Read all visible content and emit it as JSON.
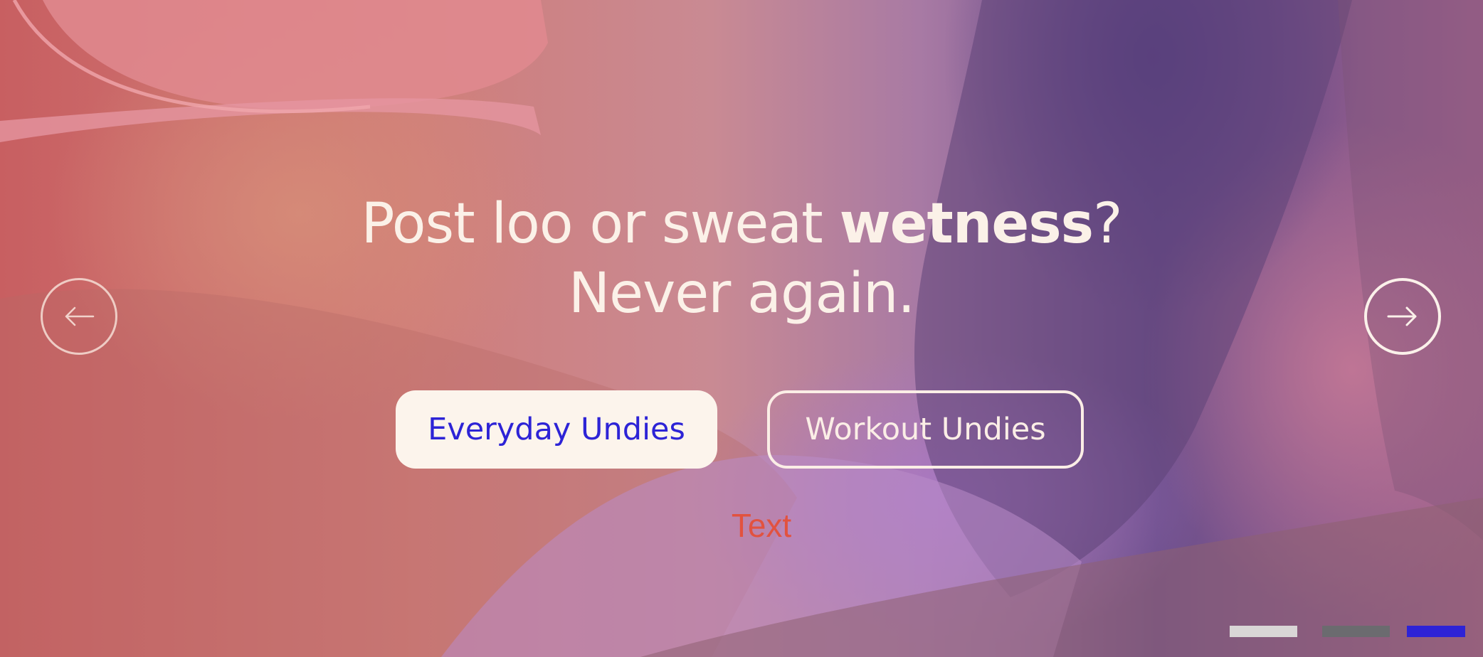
{
  "hero": {
    "headline_prefix": "Post loo or sweat ",
    "headline_bold": "wetness",
    "headline_suffix": "?",
    "headline_line2": "Never again."
  },
  "buttons": {
    "primary_label": "Everyday Undies",
    "secondary_label": "Workout Undies"
  },
  "caption": "Text",
  "navigation": {
    "prev_icon": "arrow-left-icon",
    "next_icon": "arrow-right-icon"
  },
  "pagination": {
    "count": 3,
    "active_index": 3,
    "colors": [
      "#d9d6d6",
      "#6b6b6f",
      "#2d23d6"
    ]
  },
  "colors": {
    "text_light": "#fbf1e8",
    "accent_blue": "#2d23d6",
    "accent_red": "#e2523f"
  }
}
